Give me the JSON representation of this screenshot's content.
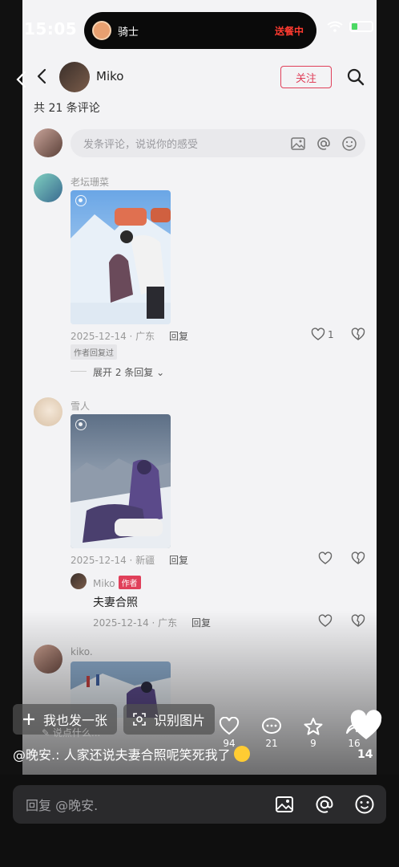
{
  "status": {
    "time": "15:05",
    "island_title": "骑士",
    "island_status": "送餐中"
  },
  "header": {
    "author": "Miko",
    "follow": "关注"
  },
  "comments_header": {
    "count_text": "共 21 条评论"
  },
  "input": {
    "placeholder": "发条评论，说说你的感受"
  },
  "comments": [
    {
      "name": "老坛珊菜",
      "meta": "2025-12-14 · 广东",
      "reply": "回复",
      "likes": "1",
      "author_tag": "作者回复过",
      "expand": "展开 2 条回复"
    },
    {
      "name": "雪人",
      "meta": "2025-12-14 · 新疆",
      "reply": "回复",
      "sub_reply": {
        "name": "Miko",
        "badge": "作者",
        "text": "夫妻合照",
        "meta": "2025-12-14 · 广东",
        "reply": "回复"
      }
    },
    {
      "name": "kiko."
    }
  ],
  "overlay": {
    "post_btn": "我也发一张",
    "identify_btn": "识别图片",
    "say_something": "说点什么...",
    "likes": "94",
    "comments": "21",
    "favorites": "9",
    "shares": "16",
    "big_likes": "14",
    "caption": "@晚安.: 人家还说夫妻合照呢笑死我了"
  },
  "reply_bar": {
    "placeholder": "回复 @晚安."
  }
}
